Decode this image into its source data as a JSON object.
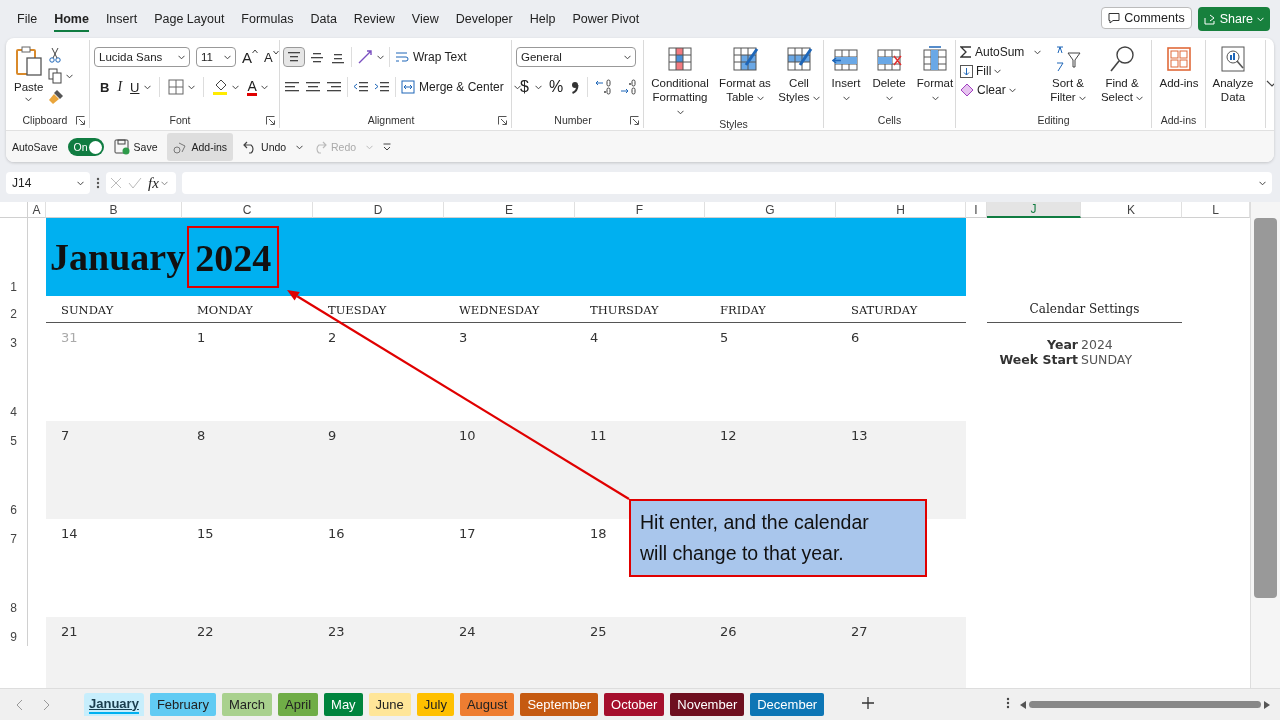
{
  "menu_tabs": [
    {
      "label": "File",
      "selected": false
    },
    {
      "label": "Home",
      "selected": true
    },
    {
      "label": "Insert",
      "selected": false
    },
    {
      "label": "Page Layout",
      "selected": false
    },
    {
      "label": "Formulas",
      "selected": false
    },
    {
      "label": "Data",
      "selected": false
    },
    {
      "label": "Review",
      "selected": false
    },
    {
      "label": "View",
      "selected": false
    },
    {
      "label": "Developer",
      "selected": false
    },
    {
      "label": "Help",
      "selected": false
    },
    {
      "label": "Power Pivot",
      "selected": false
    }
  ],
  "header_buttons": {
    "comments": "Comments",
    "share": "Share"
  },
  "ribbon": {
    "groups": [
      {
        "kind": "clipboard",
        "label": "Clipboard",
        "paste": "Paste"
      },
      {
        "kind": "font",
        "label": "Font",
        "font_name": "Lucida Sans",
        "font_size": "11",
        "grow": "A",
        "shrink": "A",
        "bold": "B",
        "italic": "I",
        "underline": "U",
        "font_color": "A"
      },
      {
        "kind": "alignment",
        "label": "Alignment",
        "top_align_pressed": true,
        "wrap_text": "Wrap Text",
        "merge": "Merge & Center"
      },
      {
        "kind": "number",
        "label": "Number",
        "format": "General",
        "currency": "$",
        "percent": "%"
      },
      {
        "kind": "styles",
        "label": "Styles",
        "buttons": [
          "Conditional Formatting",
          "Format as Table",
          "Cell Styles"
        ]
      },
      {
        "kind": "cells",
        "label": "Cells",
        "buttons": [
          "Insert",
          "Delete",
          "Format"
        ]
      },
      {
        "kind": "editing",
        "label": "Editing",
        "autosum": "AutoSum",
        "fill": "Fill",
        "clear": "Clear",
        "buttons": [
          "Sort & Filter",
          "Find & Select"
        ]
      },
      {
        "kind": "addins",
        "label": "Add-ins",
        "buttons": [
          "Add-ins"
        ]
      },
      {
        "kind": "analyze",
        "buttons": [
          "Analyze Data"
        ]
      }
    ]
  },
  "quick_access": {
    "autosave": {
      "label": "AutoSave",
      "on": true,
      "state_text": "On"
    },
    "save": "Save",
    "addins": {
      "label": "Add-ins",
      "highlighted": true
    },
    "undo": {
      "label": "Undo",
      "disabled": false
    },
    "redo": {
      "label": "Redo",
      "disabled": true
    }
  },
  "formula_bar": {
    "name_box": "J14",
    "fx": "fx"
  },
  "sheet": {
    "columns": [
      {
        "label": "A",
        "selected": false
      },
      {
        "label": "B",
        "selected": false
      },
      {
        "label": "C",
        "selected": false
      },
      {
        "label": "D",
        "selected": false
      },
      {
        "label": "E",
        "selected": false
      },
      {
        "label": "F",
        "selected": false
      },
      {
        "label": "G",
        "selected": false
      },
      {
        "label": "H",
        "selected": false
      },
      {
        "label": "I",
        "selected": false
      },
      {
        "label": "J",
        "selected": true
      },
      {
        "label": "K",
        "selected": false
      },
      {
        "label": "L",
        "selected": false
      }
    ],
    "row_headers": [
      "1",
      "2",
      "3",
      "4",
      "5",
      "6",
      "7",
      "8",
      "9"
    ],
    "calendar": {
      "month": "January",
      "year": "2024",
      "weekdays": [
        "SUNDAY",
        "MONDAY",
        "TUESDAY",
        "WEDNESDAY",
        "THURSDAY",
        "FRIDAY",
        "SATURDAY"
      ],
      "weeks": [
        [
          {
            "day": "31",
            "in_month": false
          },
          {
            "day": "1",
            "in_month": true
          },
          {
            "day": "2",
            "in_month": true
          },
          {
            "day": "3",
            "in_month": true
          },
          {
            "day": "4",
            "in_month": true
          },
          {
            "day": "5",
            "in_month": true
          },
          {
            "day": "6",
            "in_month": true
          }
        ],
        [
          {
            "day": "7",
            "in_month": true
          },
          {
            "day": "8",
            "in_month": true
          },
          {
            "day": "9",
            "in_month": true
          },
          {
            "day": "10",
            "in_month": true
          },
          {
            "day": "11",
            "in_month": true
          },
          {
            "day": "12",
            "in_month": true
          },
          {
            "day": "13",
            "in_month": true
          }
        ],
        [
          {
            "day": "14",
            "in_month": true
          },
          {
            "day": "15",
            "in_month": true
          },
          {
            "day": "16",
            "in_month": true
          },
          {
            "day": "17",
            "in_month": true
          },
          {
            "day": "18",
            "in_month": true
          }
        ],
        [
          {
            "day": "21",
            "in_month": true
          },
          {
            "day": "22",
            "in_month": true
          },
          {
            "day": "23",
            "in_month": true
          },
          {
            "day": "24",
            "in_month": true
          },
          {
            "day": "25",
            "in_month": true
          },
          {
            "day": "26",
            "in_month": true
          },
          {
            "day": "27",
            "in_month": true
          }
        ]
      ]
    },
    "settings": {
      "title": "Calendar Settings",
      "fields": [
        {
          "label": "Year",
          "value": "2024"
        },
        {
          "label": "Week Start",
          "value": "SUNDAY"
        }
      ]
    },
    "callout": "Hit enter, and the calendar will change to that year."
  },
  "sheet_tabs": [
    {
      "label": "January",
      "color": "#00b0f0",
      "selected": true
    },
    {
      "label": "February",
      "color": "#61cbf3",
      "selected": false
    },
    {
      "label": "March",
      "color": "#a9d18e",
      "selected": false
    },
    {
      "label": "April",
      "color": "#70ad47",
      "selected": false
    },
    {
      "label": "May",
      "color": "#00843d",
      "selected": false
    },
    {
      "label": "June",
      "color": "#ffe699",
      "selected": false
    },
    {
      "label": "July",
      "color": "#ffc000",
      "selected": false
    },
    {
      "label": "August",
      "color": "#ee7d31",
      "selected": false
    },
    {
      "label": "September",
      "color": "#c55a11",
      "selected": false
    },
    {
      "label": "October",
      "color": "#a50f2d",
      "selected": false
    },
    {
      "label": "November",
      "color": "#6e0f1f",
      "selected": false
    },
    {
      "label": "December",
      "color": "#0e76b5",
      "selected": false
    }
  ]
}
